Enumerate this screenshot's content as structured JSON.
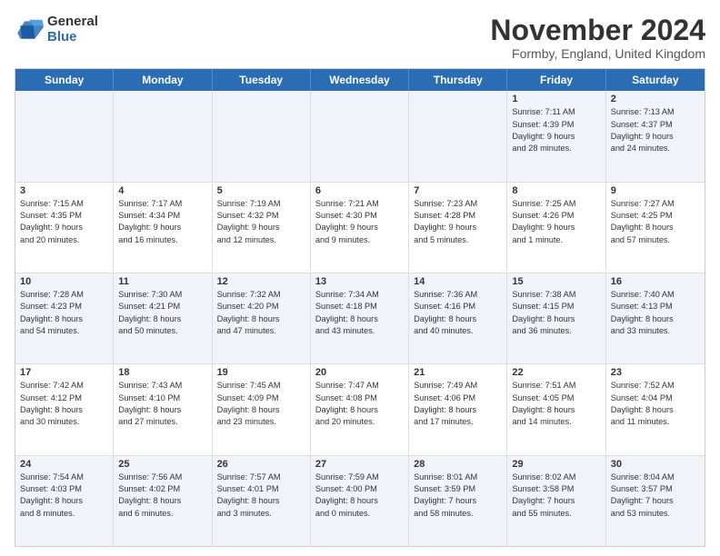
{
  "logo": {
    "general": "General",
    "blue": "Blue"
  },
  "title": "November 2024",
  "location": "Formby, England, United Kingdom",
  "headers": [
    "Sunday",
    "Monday",
    "Tuesday",
    "Wednesday",
    "Thursday",
    "Friday",
    "Saturday"
  ],
  "rows": [
    [
      {
        "day": "",
        "info": ""
      },
      {
        "day": "",
        "info": ""
      },
      {
        "day": "",
        "info": ""
      },
      {
        "day": "",
        "info": ""
      },
      {
        "day": "",
        "info": ""
      },
      {
        "day": "1",
        "info": "Sunrise: 7:11 AM\nSunset: 4:39 PM\nDaylight: 9 hours\nand 28 minutes."
      },
      {
        "day": "2",
        "info": "Sunrise: 7:13 AM\nSunset: 4:37 PM\nDaylight: 9 hours\nand 24 minutes."
      }
    ],
    [
      {
        "day": "3",
        "info": "Sunrise: 7:15 AM\nSunset: 4:35 PM\nDaylight: 9 hours\nand 20 minutes."
      },
      {
        "day": "4",
        "info": "Sunrise: 7:17 AM\nSunset: 4:34 PM\nDaylight: 9 hours\nand 16 minutes."
      },
      {
        "day": "5",
        "info": "Sunrise: 7:19 AM\nSunset: 4:32 PM\nDaylight: 9 hours\nand 12 minutes."
      },
      {
        "day": "6",
        "info": "Sunrise: 7:21 AM\nSunset: 4:30 PM\nDaylight: 9 hours\nand 9 minutes."
      },
      {
        "day": "7",
        "info": "Sunrise: 7:23 AM\nSunset: 4:28 PM\nDaylight: 9 hours\nand 5 minutes."
      },
      {
        "day": "8",
        "info": "Sunrise: 7:25 AM\nSunset: 4:26 PM\nDaylight: 9 hours\nand 1 minute."
      },
      {
        "day": "9",
        "info": "Sunrise: 7:27 AM\nSunset: 4:25 PM\nDaylight: 8 hours\nand 57 minutes."
      }
    ],
    [
      {
        "day": "10",
        "info": "Sunrise: 7:28 AM\nSunset: 4:23 PM\nDaylight: 8 hours\nand 54 minutes."
      },
      {
        "day": "11",
        "info": "Sunrise: 7:30 AM\nSunset: 4:21 PM\nDaylight: 8 hours\nand 50 minutes."
      },
      {
        "day": "12",
        "info": "Sunrise: 7:32 AM\nSunset: 4:20 PM\nDaylight: 8 hours\nand 47 minutes."
      },
      {
        "day": "13",
        "info": "Sunrise: 7:34 AM\nSunset: 4:18 PM\nDaylight: 8 hours\nand 43 minutes."
      },
      {
        "day": "14",
        "info": "Sunrise: 7:36 AM\nSunset: 4:16 PM\nDaylight: 8 hours\nand 40 minutes."
      },
      {
        "day": "15",
        "info": "Sunrise: 7:38 AM\nSunset: 4:15 PM\nDaylight: 8 hours\nand 36 minutes."
      },
      {
        "day": "16",
        "info": "Sunrise: 7:40 AM\nSunset: 4:13 PM\nDaylight: 8 hours\nand 33 minutes."
      }
    ],
    [
      {
        "day": "17",
        "info": "Sunrise: 7:42 AM\nSunset: 4:12 PM\nDaylight: 8 hours\nand 30 minutes."
      },
      {
        "day": "18",
        "info": "Sunrise: 7:43 AM\nSunset: 4:10 PM\nDaylight: 8 hours\nand 27 minutes."
      },
      {
        "day": "19",
        "info": "Sunrise: 7:45 AM\nSunset: 4:09 PM\nDaylight: 8 hours\nand 23 minutes."
      },
      {
        "day": "20",
        "info": "Sunrise: 7:47 AM\nSunset: 4:08 PM\nDaylight: 8 hours\nand 20 minutes."
      },
      {
        "day": "21",
        "info": "Sunrise: 7:49 AM\nSunset: 4:06 PM\nDaylight: 8 hours\nand 17 minutes."
      },
      {
        "day": "22",
        "info": "Sunrise: 7:51 AM\nSunset: 4:05 PM\nDaylight: 8 hours\nand 14 minutes."
      },
      {
        "day": "23",
        "info": "Sunrise: 7:52 AM\nSunset: 4:04 PM\nDaylight: 8 hours\nand 11 minutes."
      }
    ],
    [
      {
        "day": "24",
        "info": "Sunrise: 7:54 AM\nSunset: 4:03 PM\nDaylight: 8 hours\nand 8 minutes."
      },
      {
        "day": "25",
        "info": "Sunrise: 7:56 AM\nSunset: 4:02 PM\nDaylight: 8 hours\nand 6 minutes."
      },
      {
        "day": "26",
        "info": "Sunrise: 7:57 AM\nSunset: 4:01 PM\nDaylight: 8 hours\nand 3 minutes."
      },
      {
        "day": "27",
        "info": "Sunrise: 7:59 AM\nSunset: 4:00 PM\nDaylight: 8 hours\nand 0 minutes."
      },
      {
        "day": "28",
        "info": "Sunrise: 8:01 AM\nSunset: 3:59 PM\nDaylight: 7 hours\nand 58 minutes."
      },
      {
        "day": "29",
        "info": "Sunrise: 8:02 AM\nSunset: 3:58 PM\nDaylight: 7 hours\nand 55 minutes."
      },
      {
        "day": "30",
        "info": "Sunrise: 8:04 AM\nSunset: 3:57 PM\nDaylight: 7 hours\nand 53 minutes."
      }
    ]
  ]
}
